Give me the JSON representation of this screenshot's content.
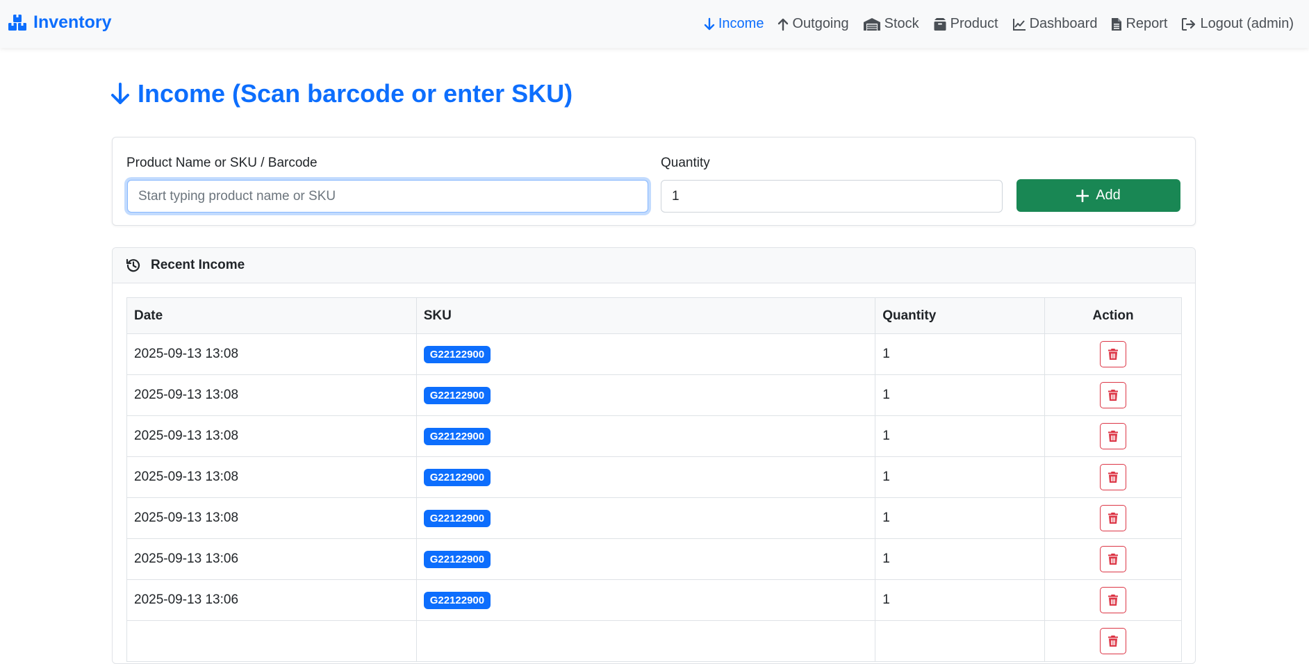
{
  "navbar": {
    "brand": "Inventory",
    "items": [
      {
        "label": "Income",
        "icon": "arrow-down-icon",
        "active": true
      },
      {
        "label": "Outgoing",
        "icon": "arrow-up-icon",
        "active": false
      },
      {
        "label": "Stock",
        "icon": "warehouse-icon",
        "active": false
      },
      {
        "label": "Product",
        "icon": "box-icon",
        "active": false
      },
      {
        "label": "Dashboard",
        "icon": "chart-line-icon",
        "active": false
      },
      {
        "label": "Report",
        "icon": "file-icon",
        "active": false
      },
      {
        "label": "Logout (admin)",
        "icon": "logout-icon",
        "active": false
      }
    ]
  },
  "page": {
    "title": "Income (Scan barcode or enter SKU)"
  },
  "form": {
    "product_label": "Product Name or SKU / Barcode",
    "product_placeholder": "Start typing product name or SKU",
    "product_value": "",
    "quantity_label": "Quantity",
    "quantity_value": "1",
    "add_label": "Add"
  },
  "recent": {
    "title": "Recent Income",
    "columns": [
      "Date",
      "SKU",
      "Quantity",
      "Action"
    ],
    "rows": [
      {
        "date": "2025-09-13 13:08",
        "sku": "G22122900",
        "quantity": "1"
      },
      {
        "date": "2025-09-13 13:08",
        "sku": "G22122900",
        "quantity": "1"
      },
      {
        "date": "2025-09-13 13:08",
        "sku": "G22122900",
        "quantity": "1"
      },
      {
        "date": "2025-09-13 13:08",
        "sku": "G22122900",
        "quantity": "1"
      },
      {
        "date": "2025-09-13 13:08",
        "sku": "G22122900",
        "quantity": "1"
      },
      {
        "date": "2025-09-13 13:06",
        "sku": "G22122900",
        "quantity": "1"
      },
      {
        "date": "2025-09-13 13:06",
        "sku": "G22122900",
        "quantity": "1"
      },
      {
        "date": "",
        "sku": "",
        "quantity": ""
      }
    ]
  },
  "colors": {
    "primary": "#0d6efd",
    "success": "#198754",
    "danger": "#dc3545"
  }
}
